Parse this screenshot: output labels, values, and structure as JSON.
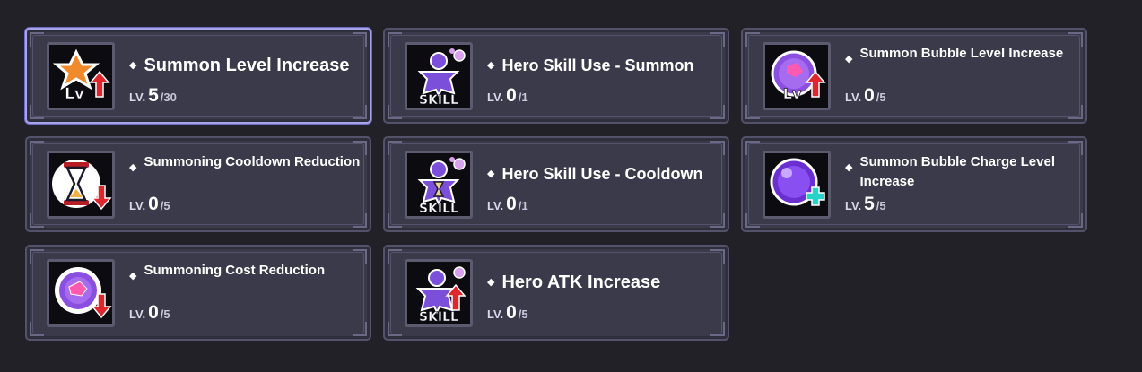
{
  "level_prefix": "LV.",
  "skills": [
    {
      "title": "Summon Level Increase",
      "level": "5",
      "max": "/30",
      "icon": "summon-level-icon",
      "selected": true
    },
    {
      "title": "Hero Skill Use - Summon",
      "level": "0",
      "max": "/1",
      "icon": "hero-skill-summon-icon",
      "selected": false
    },
    {
      "title": "Summon Bubble Level Increase",
      "level": "0",
      "max": "/5",
      "icon": "summon-bubble-level-icon",
      "selected": false
    },
    {
      "title": "Summoning Cooldown Reduction",
      "level": "0",
      "max": "/5",
      "icon": "hourglass-cooldown-icon",
      "selected": false
    },
    {
      "title": "Hero Skill Use - Cooldown",
      "level": "0",
      "max": "/1",
      "icon": "hero-skill-cooldown-icon",
      "selected": false
    },
    {
      "title": "Summon Bubble Charge Level Increase",
      "level": "5",
      "max": "/5",
      "icon": "summon-bubble-charge-icon",
      "selected": false
    },
    {
      "title": "Summoning Cost Reduction",
      "level": "0",
      "max": "/5",
      "icon": "summoning-cost-icon",
      "selected": false
    },
    {
      "title": "Hero ATK Increase",
      "level": "0",
      "max": "/5",
      "icon": "hero-atk-icon",
      "selected": false
    }
  ],
  "colors": {
    "background": "#222127",
    "card": "#3b3a4a",
    "selected_border": "#a8a4ea",
    "hero_purple": "#7b4fd9",
    "star_orange": "#f08a2a",
    "arrow_red": "#e0262d",
    "plus_cyan": "#26d3c9"
  }
}
